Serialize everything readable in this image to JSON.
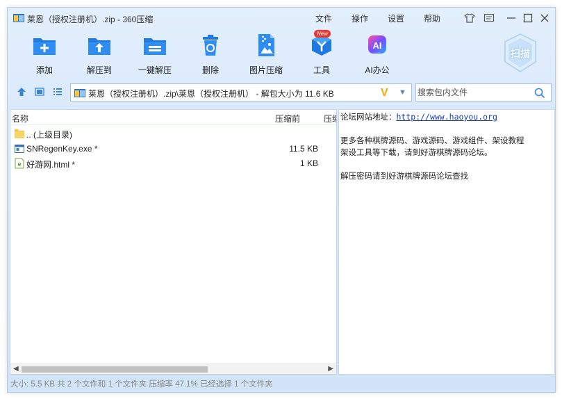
{
  "window": {
    "title": "莱恩（授权注册机）.zip - 360压缩"
  },
  "menu": {
    "file": "文件",
    "operate": "操作",
    "settings": "设置",
    "help": "帮助"
  },
  "toolbar": {
    "add": "添加",
    "extract_to": "解压到",
    "one_click_extract": "一键解压",
    "delete": "删除",
    "image_compress": "图片压缩",
    "tools": "工具",
    "tools_badge": "New",
    "ai_office": "AI办公",
    "scan": "扫描"
  },
  "address": {
    "path": "莱恩（授权注册机）.zip\\莱恩（授权注册机） - 解包大小为 11.6 KB",
    "v_mark": "V"
  },
  "search": {
    "placeholder": "搜索包内文件"
  },
  "file_list": {
    "columns": {
      "name": "名称",
      "compressed_before": "压缩前",
      "compressed_after": "压缩"
    },
    "rows": [
      {
        "name": ".. (上级目录)",
        "size": ""
      },
      {
        "name": "SNRegenKey.exe *",
        "size": "11.5 KB"
      },
      {
        "name": "好游网.html *",
        "size": "1 KB"
      }
    ]
  },
  "comment": {
    "line1_label": "论坛网站地址：",
    "line1_link": "http://www.haoyou.org",
    "line2": "更多各种棋牌源码、游戏源码、游戏组件、架设教程",
    "line3": "架设工具等下载，请到好游棋牌源码论坛。",
    "line4": "解压密码请到好游棋牌源码论坛查找"
  },
  "status": {
    "text": "大小: 5.5 KB 共 2 个文件和 1 个文件夹 压缩率 47.1% 已经选择 1 个文件夹"
  },
  "colors": {
    "accent_blue": "#1e7ae0",
    "badge_red": "#e8362f",
    "v_yellow": "#f2a900"
  }
}
